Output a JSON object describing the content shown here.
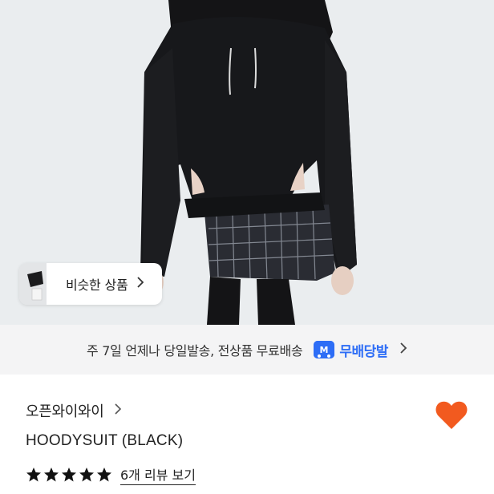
{
  "hero": {
    "image_alt": "Model wearing black hoodie bodysuit with plaid mini skirt",
    "similar_button": {
      "label": "비슷한 상품",
      "chevron": "chevron-right-icon"
    }
  },
  "shipping": {
    "text": "주 7일 언제나 당일발송, 전상품 무료배송",
    "badge_icon": "delivery-truck-icon",
    "badge_label": "무배당발",
    "chevron": "chevron-right-icon",
    "accent_color": "#2d6df6"
  },
  "product": {
    "shop_name": "오픈와이와이",
    "title": "HOODYSUIT (BLACK)",
    "rating": 5,
    "rating_max": 5,
    "review_link": "6개 리뷰 보기",
    "wishlist_icon": "heart-icon",
    "wishlist_color": "#f25a1f"
  }
}
